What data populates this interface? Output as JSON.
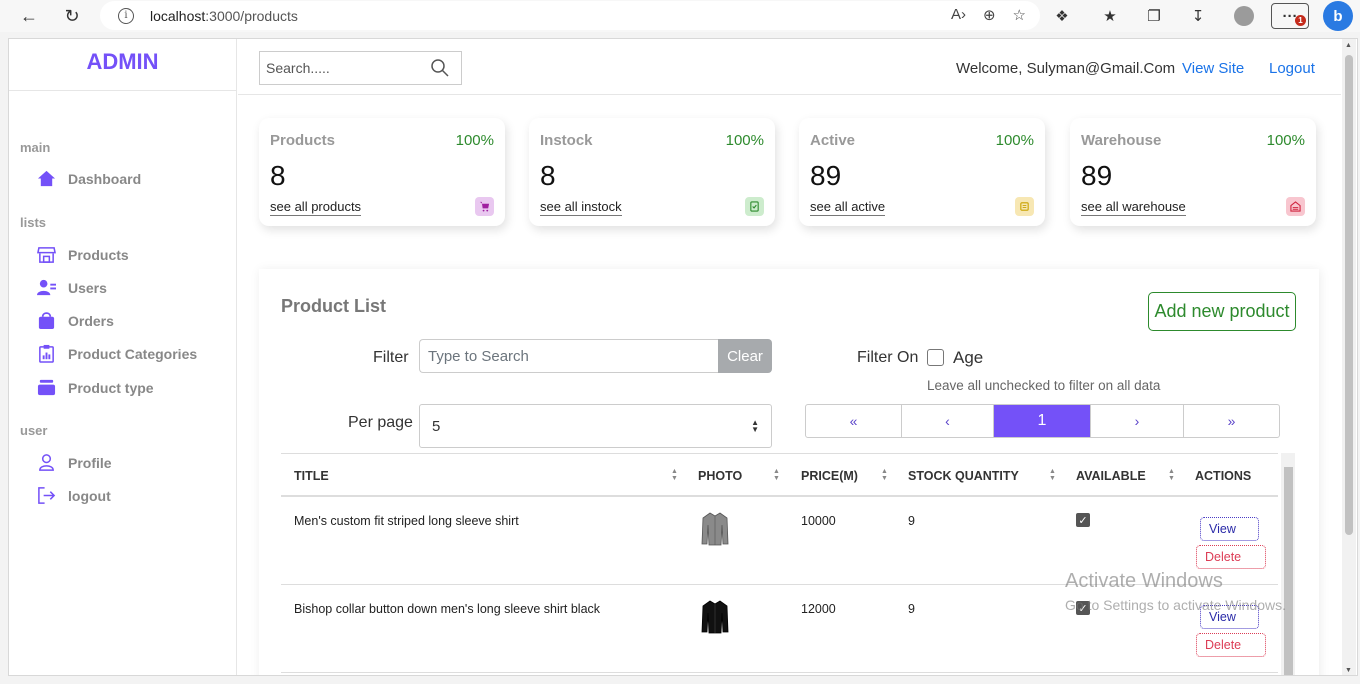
{
  "browser": {
    "url_host": "localhost",
    "url_path": ":3000/products"
  },
  "sidebar": {
    "logo": "ADMIN",
    "sections": [
      {
        "title": "main",
        "items": [
          {
            "label": "Dashboard",
            "icon": "home-icon"
          }
        ]
      },
      {
        "title": "lists",
        "items": [
          {
            "label": "Products",
            "icon": "store-icon"
          },
          {
            "label": "Users",
            "icon": "users-icon"
          },
          {
            "label": "Orders",
            "icon": "bag-icon"
          },
          {
            "label": "Product Categories",
            "icon": "chart-clipboard-icon"
          },
          {
            "label": "Product type",
            "icon": "layers-icon"
          }
        ]
      },
      {
        "title": "user",
        "items": [
          {
            "label": "Profile",
            "icon": "person-icon"
          },
          {
            "label": "logout",
            "icon": "logout-icon"
          }
        ]
      }
    ]
  },
  "topbar": {
    "search_placeholder": "Search.....",
    "welcome": "Welcome, Sulyman@Gmail.Com",
    "view_site": "View Site",
    "logout": "Logout"
  },
  "widgets": [
    {
      "title": "Products",
      "percent": "100%",
      "value": "8",
      "link": "see all products",
      "icon": "cart-icon",
      "icon_color": "#a020a0",
      "icon_bg": "#e9c8f0"
    },
    {
      "title": "Instock",
      "percent": "100%",
      "value": "8",
      "link": "see all instock",
      "icon": "stock-icon",
      "icon_color": "#2d8a2d",
      "icon_bg": "#cdeccd"
    },
    {
      "title": "Active",
      "percent": "100%",
      "value": "89",
      "link": "see all active",
      "icon": "active-icon",
      "icon_color": "#c9a200",
      "icon_bg": "#f7e7b3"
    },
    {
      "title": "Warehouse",
      "percent": "100%",
      "value": "89",
      "link": "see all warehouse",
      "icon": "warehouse-icon",
      "icon_color": "#d0243f",
      "icon_bg": "#f8c6cf"
    }
  ],
  "product_list": {
    "title": "Product List",
    "add_button": "Add new product",
    "filter_label": "Filter",
    "filter_placeholder": "Type to Search",
    "clear_button": "Clear",
    "filter_on_label": "Filter On",
    "age_label": "Age",
    "hint": "Leave all unchecked to filter on all data",
    "per_page_label": "Per page",
    "per_page_value": "5",
    "pagination": [
      "«",
      "‹",
      "1",
      "›",
      "»"
    ],
    "columns": [
      "TITLE",
      "PHOTO",
      "PRICE(M)",
      "STOCK QUANTITY",
      "AVAILABLE",
      "ACTIONS"
    ],
    "rows": [
      {
        "title": "Men's custom fit striped long sleeve shirt",
        "photo": "shirt-grey",
        "price": "10000",
        "stock": "9",
        "available": true
      },
      {
        "title": "Bishop collar button down men's long sleeve shirt black",
        "photo": "shirt-black",
        "price": "12000",
        "stock": "9",
        "available": true
      }
    ],
    "view_label": "View",
    "delete_label": "Delete"
  },
  "watermark": {
    "line1": "Activate Windows",
    "line2": "Go to Settings to activate Windows."
  }
}
